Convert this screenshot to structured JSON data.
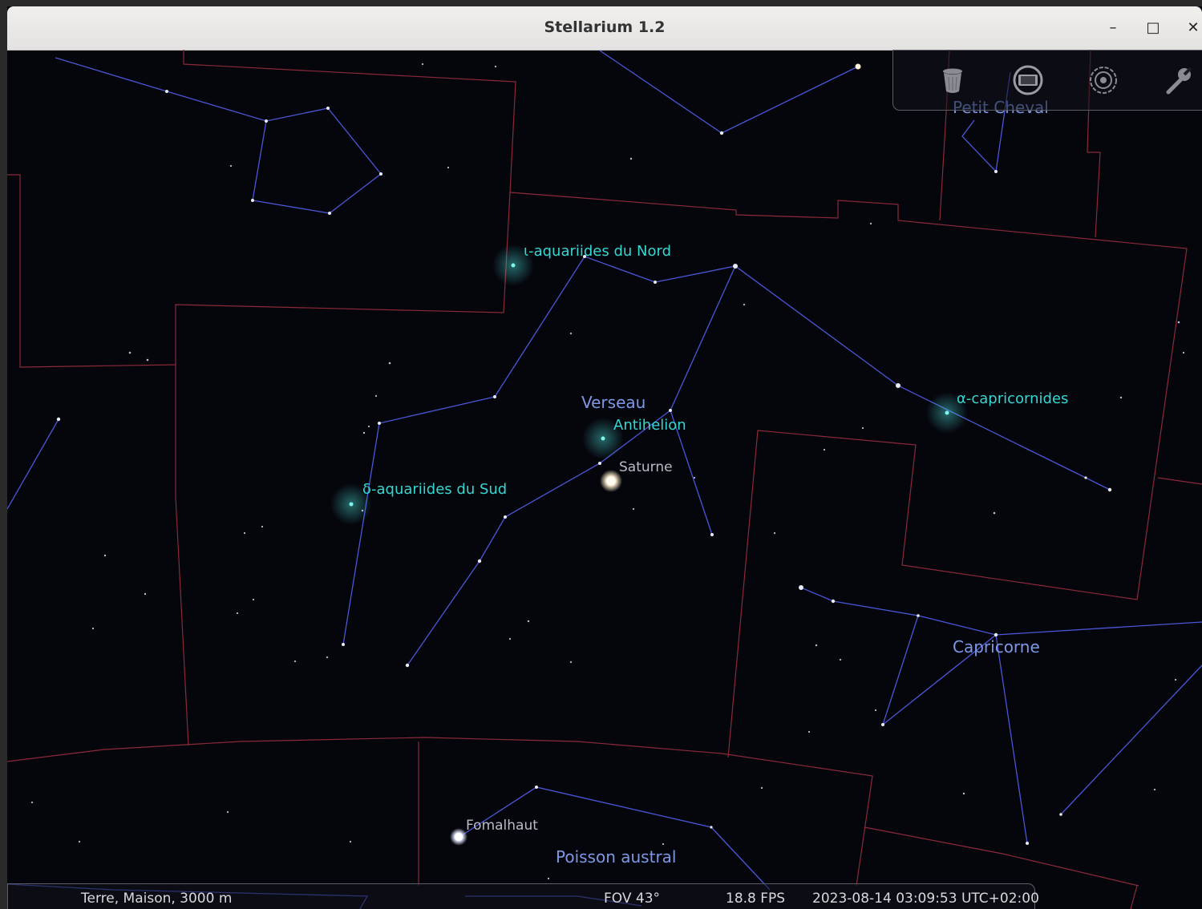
{
  "window": {
    "title": "Stellarium 1.2",
    "minimize_glyph": "–",
    "maximize_glyph": "□",
    "close_glyph": "✕"
  },
  "toolbar": {
    "icons": [
      "trash-icon",
      "screen-icon",
      "target-icon",
      "wrench-icon"
    ]
  },
  "sky": {
    "constellations": {
      "petit_cheval": "Petit Cheval",
      "verseau": "Verseau",
      "capricorne": "Capricorne",
      "poisson_austral": "Poisson austral"
    },
    "meteor_showers": {
      "iota_aquariids_north": "ι-aquariides du Nord",
      "alpha_capricornids": "α-capricornides",
      "delta_aquariids_south": "δ-aquariides du Sud",
      "antihelion": "Antihelion"
    },
    "objects": {
      "saturn": "Saturne",
      "fomalhaut": "Fomalhaut"
    },
    "colors": {
      "constellation_lines": "#4a57d6",
      "boundaries": "#8b2a3a",
      "constellation_labels": "#7d99e6",
      "meteor_labels": "#35d7d2",
      "object_labels": "#b9bcc6",
      "background": "#05050c"
    }
  },
  "statusbar": {
    "location": "Terre, Maison, 3000 m",
    "fov": "FOV 43°",
    "fps": "18.8 FPS",
    "datetime": "2023-08-14 03:09:53 UTC+02:00"
  }
}
